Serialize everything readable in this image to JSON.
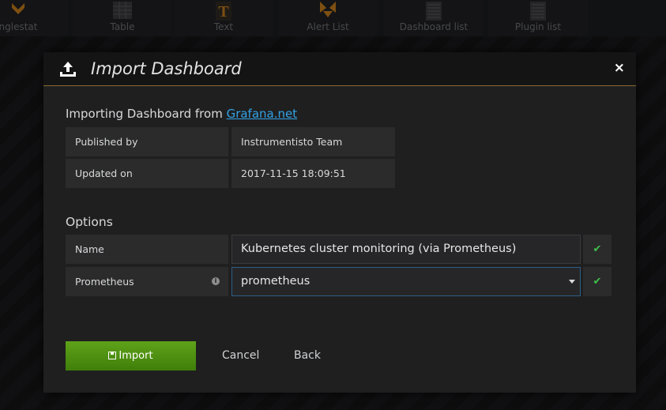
{
  "background": {
    "panels": [
      {
        "label": "nglestat",
        "icon": "singlestat-icon"
      },
      {
        "label": "Table",
        "icon": "table-icon"
      },
      {
        "label": "Text",
        "icon": "text-icon"
      },
      {
        "label": "Alert List",
        "icon": "alert-list-icon"
      },
      {
        "label": "Dashboard list",
        "icon": "dashboard-list-icon"
      },
      {
        "label": "Plugin list",
        "icon": "plugin-list-icon"
      }
    ]
  },
  "modal": {
    "title": "Import Dashboard",
    "close_label": "×",
    "source": {
      "prefix": "Importing Dashboard from ",
      "link": "Grafana.net"
    },
    "info": [
      {
        "label": "Published by",
        "value": "Instrumentisto Team"
      },
      {
        "label": "Updated on",
        "value": "2017-11-15 18:09:51"
      }
    ],
    "options_heading": "Options",
    "options": {
      "name_label": "Name",
      "name_value": "Kubernetes cluster monitoring (via Prometheus)",
      "prometheus_label": "Prometheus",
      "prometheus_value": "prometheus"
    },
    "buttons": {
      "import": "Import",
      "cancel": "Cancel",
      "back": "Back"
    }
  },
  "colors": {
    "accent": "#33a2e5",
    "primary_button": "#529a14",
    "valid": "#3ec24a",
    "header_border": "#8a6a2e"
  }
}
